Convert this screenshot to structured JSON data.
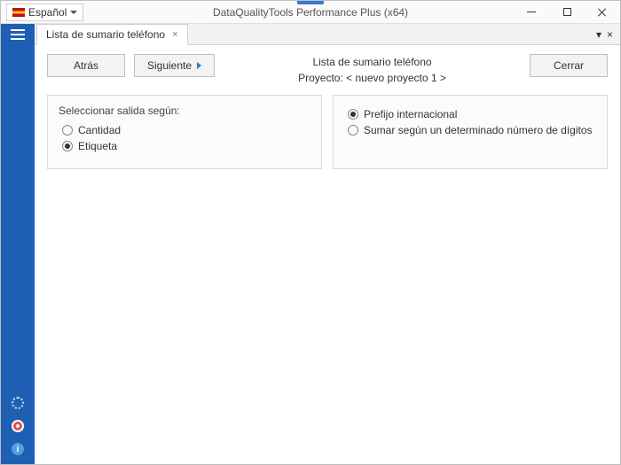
{
  "titlebar": {
    "language": "Español",
    "app_title": "DataQualityTools Performance Plus (x64)"
  },
  "tab": {
    "label": "Lista de sumario teléfono",
    "tools": {
      "dropdown": "▾",
      "close": "×"
    }
  },
  "toolbar": {
    "back_label": "Atrás",
    "next_label": "Siguiente",
    "close_label": "Cerrar"
  },
  "header": {
    "title": "Lista de sumario teléfono",
    "project_line": "Proyecto: < nuevo proyecto 1 >"
  },
  "left_panel": {
    "title": "Seleccionar salida según:",
    "options": [
      {
        "label": "Cantidad",
        "checked": false
      },
      {
        "label": "Etiqueta",
        "checked": true
      }
    ]
  },
  "right_panel": {
    "options": [
      {
        "label": "Prefijo internacional",
        "checked": true
      },
      {
        "label": "Sumar según un determinado número de dígitos",
        "checked": false
      }
    ]
  },
  "info_glyph": "i"
}
